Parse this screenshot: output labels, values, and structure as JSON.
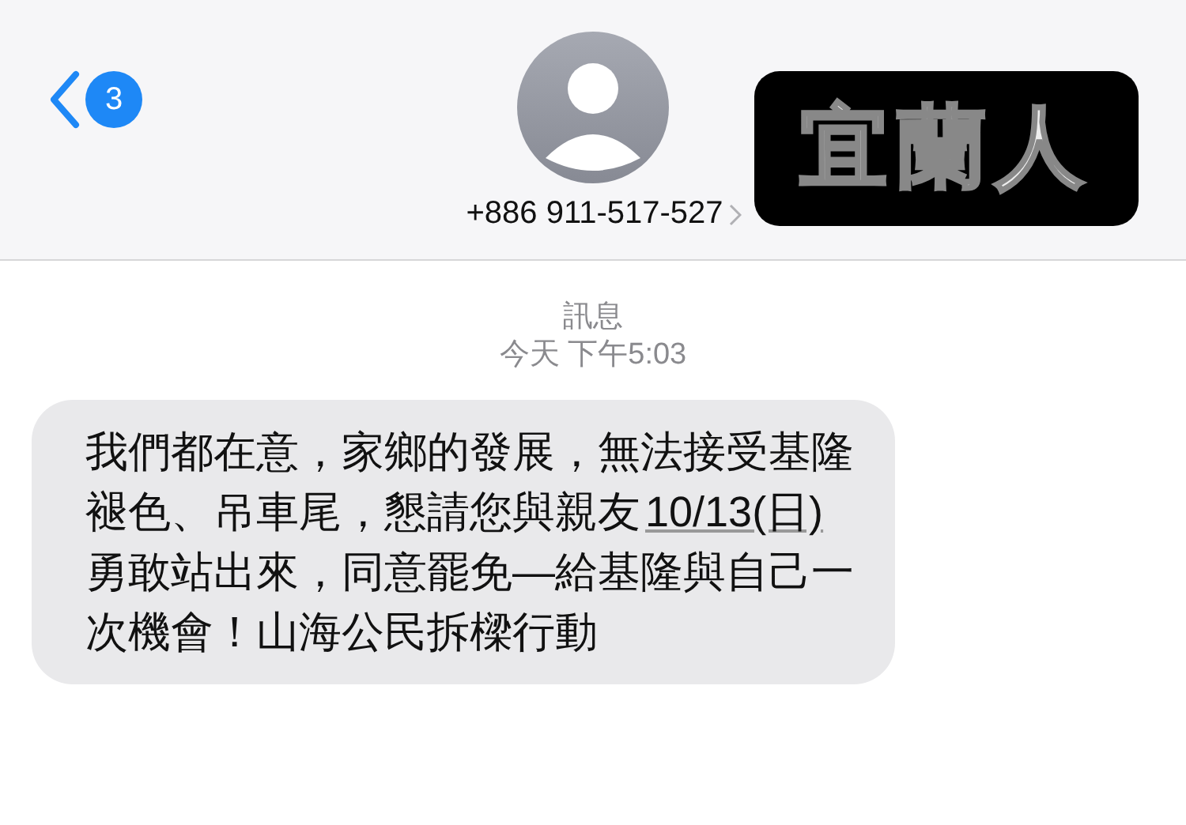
{
  "header": {
    "back_count": "3",
    "contact": "+886 911-517-527"
  },
  "sticker": {
    "text": "宜蘭人"
  },
  "conversation": {
    "service": "訊息",
    "timestamp": "今天 下午5:03"
  },
  "message": {
    "text_before": "我們都在意，家鄉的發展，無法接受基隆褪色、吊車尾，懇請您與親友",
    "link": "10/13(日)",
    "text_after": "勇敢站出來，同意罷免—給基隆與自己一次機會！山海公民拆樑行動"
  }
}
